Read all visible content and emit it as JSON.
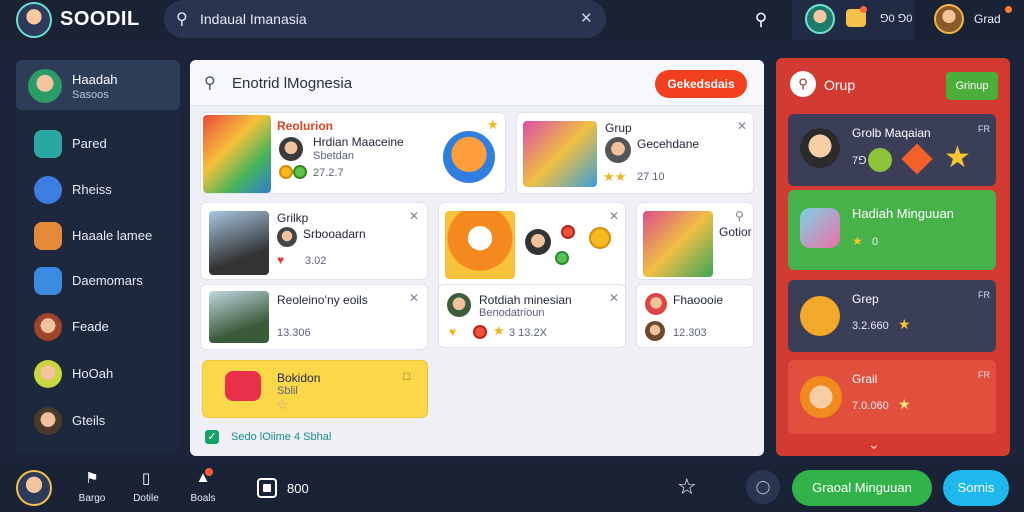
{
  "app": {
    "brand": "SOODIL",
    "search_value": "Indaual Imanasia",
    "top_user1_notif_label": "ꓨ0 ꓨ0",
    "top_user2_name": "Grad"
  },
  "sidebar": {
    "profile_name": "Haadah",
    "profile_sub": "Sasoos",
    "items": [
      {
        "label": "Pared",
        "icon": "chat-bubble-icon"
      },
      {
        "label": "Rheiss",
        "icon": "globe-icon"
      },
      {
        "label": "Haaale lamee",
        "icon": "box-icon"
      },
      {
        "label": "Daemomars",
        "icon": "list-icon"
      },
      {
        "label": "Feade",
        "icon": "avatar-icon"
      },
      {
        "label": "HoOah",
        "icon": "avatar-icon"
      },
      {
        "label": "Gteils",
        "icon": "avatar-icon"
      }
    ]
  },
  "main": {
    "search_value": "Enotrid lMognesia",
    "action_button": "Gekedsdais",
    "cards": {
      "c1": {
        "title": "Reolurion",
        "author": "Hrdian Maaceine",
        "sub": "Sbetdan",
        "count": "27.2.7"
      },
      "c2": {
        "title": "Grup",
        "author": "Gecehdane",
        "sub": "",
        "count": "27 10"
      },
      "c3": {
        "title": "Grilkp",
        "author": "Srbooadarn",
        "count": "3.02"
      },
      "c4": {
        "title": "",
        "count": ""
      },
      "c5": {
        "title": "Gotior",
        "count": ""
      },
      "c6": {
        "title": "Reoleinoʻny eoils",
        "count": "13.306"
      },
      "c7": {
        "title": "Rotdiah minesian",
        "sub": "Benodatrioun",
        "count": "3 13.2X"
      },
      "c8": {
        "title": "Fhaoooie",
        "count": "12.303"
      },
      "c9": {
        "title": "Bokidon",
        "sub": "Sblil"
      }
    },
    "check_label": "Sedo lOiime 4 Sbhal"
  },
  "group": {
    "title": "Orup",
    "button": "Grinup",
    "items": [
      {
        "title": "Grolb Maqaian",
        "meta": "7ꓨ",
        "flag": "FR"
      },
      {
        "title": "Hadiah Minguuan",
        "meta": "0",
        "flag": ""
      },
      {
        "title": "Grep",
        "meta": "3.2.660",
        "flag": "FR"
      },
      {
        "title": "Grail",
        "meta": "7.0.060",
        "flag": "FR"
      }
    ]
  },
  "bottom": {
    "items": [
      {
        "label": "Bargo",
        "icon": "tag-icon"
      },
      {
        "label": "Dotile",
        "icon": "phone-icon"
      },
      {
        "label": "Boals",
        "icon": "megaphone-icon"
      }
    ],
    "count": "800",
    "green_button": "Graoal Minguuan",
    "blue_button": "Sornis"
  },
  "colors": {
    "accent_red": "#f2401e",
    "group_red": "#d23a32",
    "green": "#31b34a",
    "blue": "#1fb8ee"
  }
}
